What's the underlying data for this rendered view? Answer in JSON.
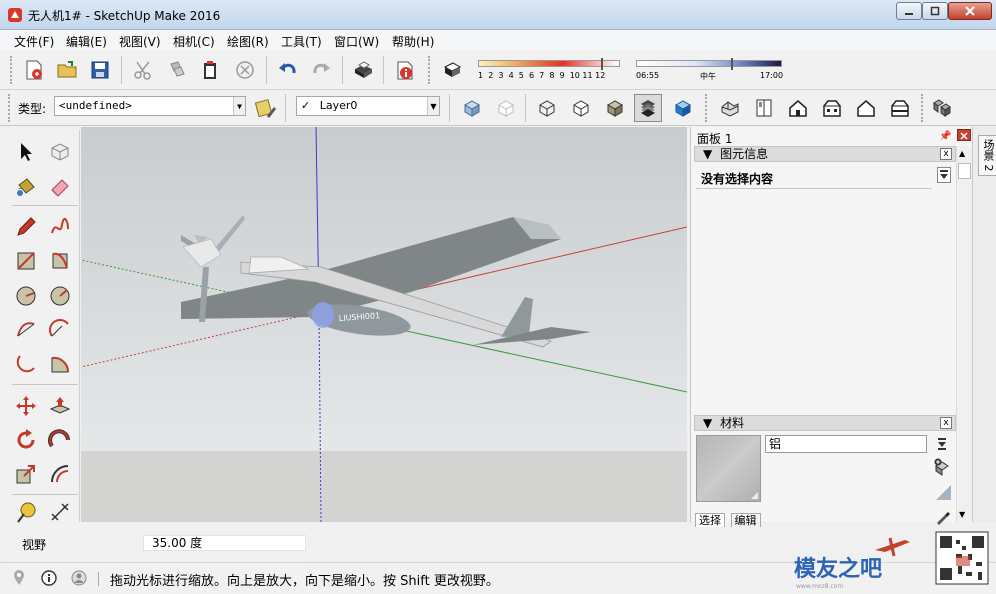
{
  "window": {
    "title": "无人机1# - SketchUp Make 2016"
  },
  "menu": [
    "文件(F)",
    "编辑(E)",
    "视图(V)",
    "相机(C)",
    "绘图(R)",
    "工具(T)",
    "窗口(W)",
    "帮助(H)"
  ],
  "shadow": {
    "months": [
      "1",
      "2",
      "3",
      "4",
      "5",
      "6",
      "7",
      "8",
      "9",
      "10",
      "11",
      "12"
    ],
    "time_start": "06:55",
    "time_mid": "中午",
    "time_end": "17:00"
  },
  "entity_type": {
    "label": "类型:",
    "value": "<undefined>"
  },
  "layer": {
    "check": "✓",
    "value": "Layer0"
  },
  "tray": {
    "title": "面板 1",
    "entity_info": {
      "header": "图元信息",
      "empty_text": "没有选择内容"
    },
    "materials": {
      "header": "材料",
      "name_value": "铝",
      "tabs": [
        "选择",
        "编辑"
      ]
    },
    "collapse_glyph": "▼",
    "close_glyph": "x"
  },
  "side_tab": {
    "label": "场景 2"
  },
  "model": {
    "fuselage_text": "LIUSHI001"
  },
  "value_control": {
    "label": "视野",
    "value": "35.00 度"
  },
  "status": {
    "hint": "拖动光标进行缩放。向上是放大，向下是缩小。按 Shift 更改视野。"
  },
  "watermark": {
    "site_text": "模友之吧",
    "url": "www.moz8.com"
  },
  "colors": {
    "title_gradient_top": "#dce8f5",
    "viewport_sky": "#c9cccf",
    "ground": "#d3d3d2",
    "axis_red": "#c8403a",
    "axis_green": "#3a9a3a",
    "axis_blue": "#3a3ad0",
    "close_button": "#c4412c"
  }
}
